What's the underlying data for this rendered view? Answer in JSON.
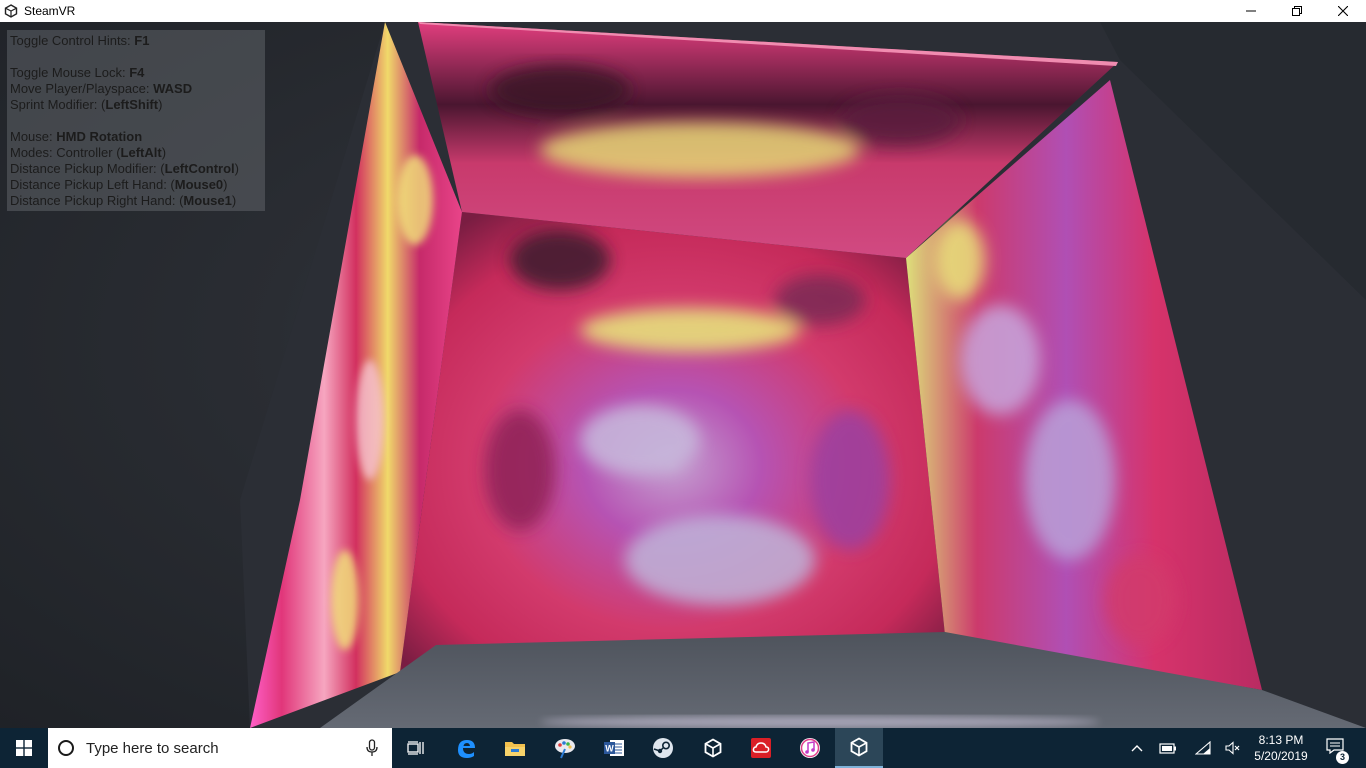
{
  "window": {
    "title": "SteamVR",
    "icon": "unity-icon",
    "controls": [
      "minimize-icon",
      "restore-icon",
      "close-icon"
    ]
  },
  "hints": {
    "toggle_hints_label": "Toggle Control Hints: ",
    "toggle_hints_key": "F1",
    "mouse_lock_label": "Toggle Mouse Lock: ",
    "mouse_lock_key": "F4",
    "move_label": "Move Player/Playspace: ",
    "move_key": "WASD",
    "sprint_label": "Sprint Modifier: (",
    "sprint_key": "LeftShift",
    "mouse_label": "Mouse: ",
    "mouse_key": "HMD Rotation",
    "modes_label": "Modes: Controller (",
    "modes_key": "LeftAlt",
    "pickup_mod_label": "Distance Pickup Modifier: (",
    "pickup_mod_key": "LeftControl",
    "pickup_left_label": "Distance Pickup Left Hand: (",
    "pickup_left_key": "Mouse0",
    "pickup_right_label": "Distance Pickup Right Hand: (",
    "pickup_right_key": "Mouse1",
    "close_paren": ")"
  },
  "taskbar": {
    "search_placeholder": "Type here to search",
    "pinned": [
      "task-view-icon",
      "edge-icon",
      "file-explorer-icon",
      "paint-icon",
      "word-icon",
      "steam-icon",
      "unity-icon",
      "creative-cloud-icon",
      "itunes-icon",
      "unity-icon"
    ],
    "active_app": "unity-icon",
    "clock_time": "8:13 PM",
    "clock_date": "5/20/2019",
    "notification_count": "3"
  },
  "colors": {
    "taskbar_bg": "#0d2435",
    "accent": "#7fb2d8",
    "wall_pink": "#d9356e",
    "wall_magenta": "#b03fa6"
  }
}
